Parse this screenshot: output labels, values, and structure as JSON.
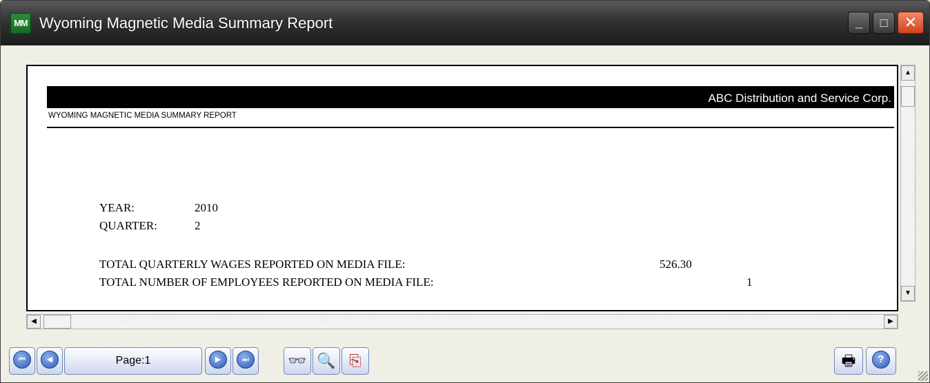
{
  "window": {
    "title": "Wyoming Magnetic Media Summary Report",
    "app_icon_text": "MM",
    "minimize_glyph": "_",
    "maximize_glyph": "□",
    "close_glyph": "✕"
  },
  "report": {
    "company_name": "ABC Distribution and Service Corp.",
    "report_title": "WYOMING MAGNETIC MEDIA SUMMARY REPORT",
    "year_label": "YEAR:",
    "year_value": "2010",
    "quarter_label": "QUARTER:",
    "quarter_value": "2",
    "wages_label": "TOTAL QUARTERLY WAGES REPORTED ON MEDIA FILE:",
    "wages_value": "526.30",
    "employees_label": "TOTAL NUMBER OF EMPLOYEES REPORTED ON MEDIA FILE:",
    "employees_value": "1"
  },
  "scrollbars": {
    "up_glyph": "▲",
    "down_glyph": "▼",
    "left_glyph": "◀",
    "right_glyph": "▶"
  },
  "toolbar": {
    "first_glyph": "⏮",
    "prev_glyph": "◀",
    "page_label": "Page:1",
    "next_glyph": "▶",
    "last_glyph": "⏭",
    "find_glyph": "👓",
    "zoom_glyph": "🔍",
    "export_glyph": "⎘",
    "print_glyph": "🖶",
    "help_glyph": "?"
  },
  "colors": {
    "titlebar": "#2b2b2b",
    "close_button": "#d0421b",
    "toolbar_button_border": "#6f88b5"
  }
}
